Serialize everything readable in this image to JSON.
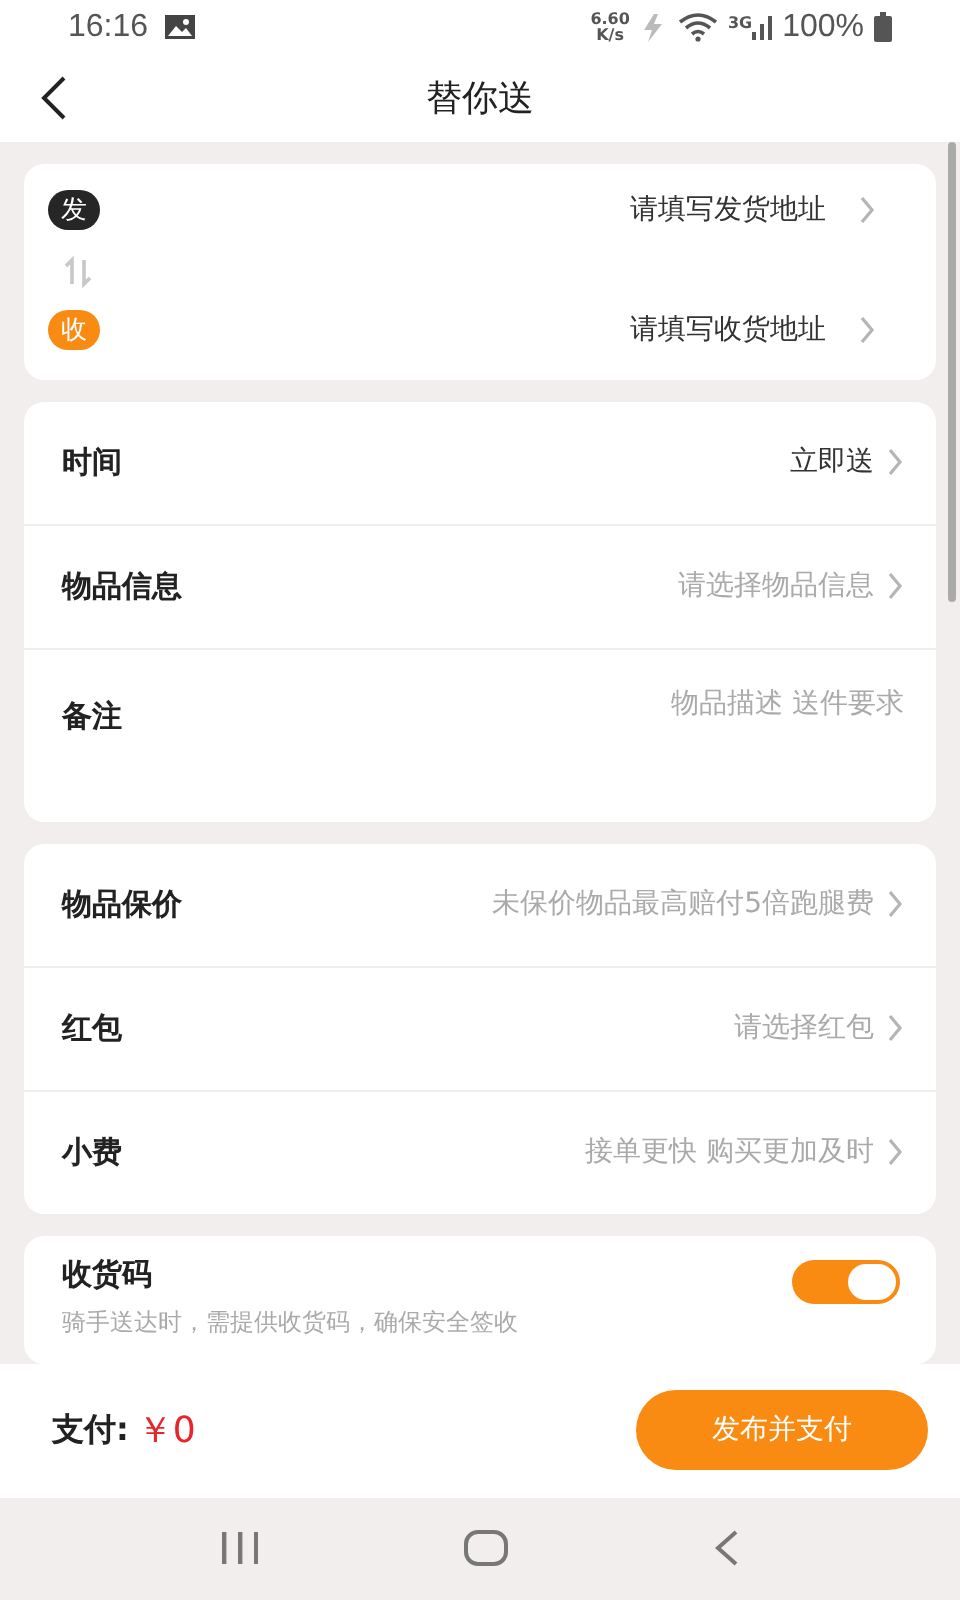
{
  "status_bar": {
    "time": "16:16",
    "speed_value": "6.60",
    "speed_unit": "K/s",
    "network": "3G",
    "battery": "100%"
  },
  "header": {
    "title": "替你送"
  },
  "address": [
    {
      "badge": "发",
      "color": "#262626",
      "placeholder": "请填写发货地址"
    },
    {
      "badge": "收",
      "color": "#f98a12",
      "placeholder": "请填写收货地址"
    }
  ],
  "sections": [
    {
      "rows": [
        {
          "kind": "select",
          "label": "时间",
          "value": "立即送"
        },
        {
          "kind": "select",
          "label": "物品信息",
          "placeholder": "请选择物品信息"
        },
        {
          "kind": "note",
          "label": "备注",
          "placeholder": "物品描述 送件要求"
        }
      ]
    },
    {
      "rows": [
        {
          "kind": "select",
          "label": "物品保价",
          "placeholder": "未保价物品最高赔付5倍跑腿费"
        },
        {
          "kind": "select",
          "label": "红包",
          "placeholder": "请选择红包"
        },
        {
          "kind": "select",
          "label": "小费",
          "placeholder": "接单更快 购买更加及时"
        }
      ]
    }
  ],
  "receipt_code": {
    "title": "收货码",
    "description": "骑手送达时，需提供收货码，确保安全签收",
    "on": true
  },
  "footer": {
    "pay_label": "支付:",
    "amount": "￥0",
    "button": "发布并支付"
  }
}
